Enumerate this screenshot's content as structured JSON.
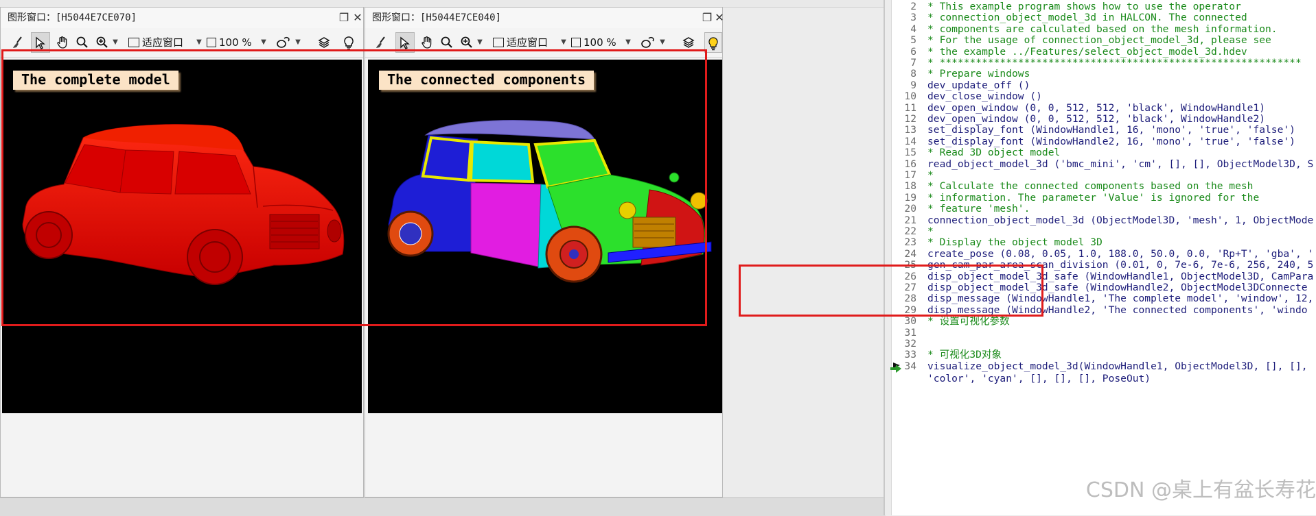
{
  "windows": [
    {
      "title_prefix": "图形窗口：",
      "title_handle": "[H5044E7CE070]",
      "toolbar": {
        "fit_label": "适应窗口",
        "zoom_label": "100 %"
      },
      "message": "The complete model",
      "image": "red-mini-car",
      "colors": {
        "car": "#e60000"
      }
    },
    {
      "title_prefix": "图形窗口：",
      "title_handle": "[H5044E7CE040]",
      "toolbar": {
        "fit_label": "适应窗口",
        "zoom_label": "100 %"
      },
      "message": "The connected components",
      "image": "multicolor-mini-car",
      "colors": {
        "roof": "#7d74d6",
        "door_front": "#e11de1",
        "side": "#1e1ed6",
        "window": "#00d8d8",
        "hood": "#2ce02c",
        "bumper": "#2020ff"
      }
    }
  ],
  "editor": {
    "lines": [
      {
        "n": "2",
        "text": "* This example program shows how to use the operator",
        "type": "comment"
      },
      {
        "n": "3",
        "text": "* connection_object_model_3d in HALCON. The connected",
        "type": "comment"
      },
      {
        "n": "4",
        "text": "* components are calculated based on the mesh information.",
        "type": "comment"
      },
      {
        "n": "5",
        "text": "* For the usage of connection_object_model_3d, please see",
        "type": "comment"
      },
      {
        "n": "6",
        "text": "* the example ../Features/select_object_model_3d.hdev",
        "type": "comment"
      },
      {
        "n": "7",
        "text": "* ************************************************************",
        "type": "comment"
      },
      {
        "n": "8",
        "text": "* Prepare windows",
        "type": "comment"
      },
      {
        "n": "9",
        "text": "dev_update_off ()",
        "type": "code"
      },
      {
        "n": "10",
        "text": "dev_close_window ()",
        "type": "code"
      },
      {
        "n": "11",
        "text": "dev_open_window (0, 0, 512, 512, 'black', WindowHandle1)",
        "type": "code"
      },
      {
        "n": "12",
        "text": "dev_open_window (0, 0, 512, 512, 'black', WindowHandle2)",
        "type": "code"
      },
      {
        "n": "13",
        "text": "set_display_font (WindowHandle1, 16, 'mono', 'true', 'false')",
        "type": "code"
      },
      {
        "n": "14",
        "text": "set_display_font (WindowHandle2, 16, 'mono', 'true', 'false')",
        "type": "code"
      },
      {
        "n": "15",
        "text": "* Read 3D object model",
        "type": "comment"
      },
      {
        "n": "16",
        "text": "read_object_model_3d ('bmc_mini', 'cm', [], [], ObjectModel3D, S",
        "type": "code"
      },
      {
        "n": "17",
        "text": "*",
        "type": "comment"
      },
      {
        "n": "18",
        "text": "* Calculate the connected components based on the mesh",
        "type": "comment"
      },
      {
        "n": "19",
        "text": "* information. The parameter 'Value' is ignored for the",
        "type": "comment"
      },
      {
        "n": "20",
        "text": "* feature 'mesh'.",
        "type": "comment"
      },
      {
        "n": "21",
        "text": "connection_object_model_3d (ObjectModel3D, 'mesh', 1, ObjectMode",
        "type": "code"
      },
      {
        "n": "22",
        "text": "*",
        "type": "comment"
      },
      {
        "n": "23",
        "text": "* Display the object model 3D",
        "type": "comment"
      },
      {
        "n": "24",
        "text": "create_pose (0.08, 0.05, 1.0, 188.0, 50.0, 0.0, 'Rp+T', 'gba', '",
        "type": "code"
      },
      {
        "n": "25",
        "text": "gen_cam_par_area_scan_division (0.01, 0, 7e-6, 7e-6, 256, 240, 5",
        "type": "code"
      },
      {
        "n": "26",
        "text": "disp_object_model_3d_safe (WindowHandle1, ObjectModel3D, CamPara",
        "type": "code"
      },
      {
        "n": "27",
        "text": "disp_object_model_3d_safe (WindowHandle2, ObjectModel3DConnecte",
        "type": "code"
      },
      {
        "n": "28",
        "text": "disp_message (WindowHandle1, 'The complete model', 'window', 12,",
        "type": "code"
      },
      {
        "n": "29",
        "text": "disp_message (WindowHandle2, 'The connected components', 'windo",
        "type": "code"
      },
      {
        "n": "30",
        "text": "* 设置可视化参数",
        "type": "comment"
      },
      {
        "n": "31",
        "text": "",
        "type": "code"
      },
      {
        "n": "32",
        "text": "",
        "type": "code"
      },
      {
        "n": "33",
        "text": "* 可视化3D对象",
        "type": "comment"
      },
      {
        "n": "34",
        "text": "visualize_object_model_3d(WindowHandle1, ObjectModel3D, [], [],",
        "type": "code"
      },
      {
        "n": "",
        "text": "'color', 'cyan', [], [], [], PoseOut)",
        "type": "code"
      }
    ],
    "watermark": "CSDN @桌上有盆长寿花"
  },
  "colors": {
    "highlight_box": "#e01b1b",
    "comment": "#1a8a1a",
    "code": "#1d1d7a",
    "pc_arrow": "#2a9a2a"
  }
}
